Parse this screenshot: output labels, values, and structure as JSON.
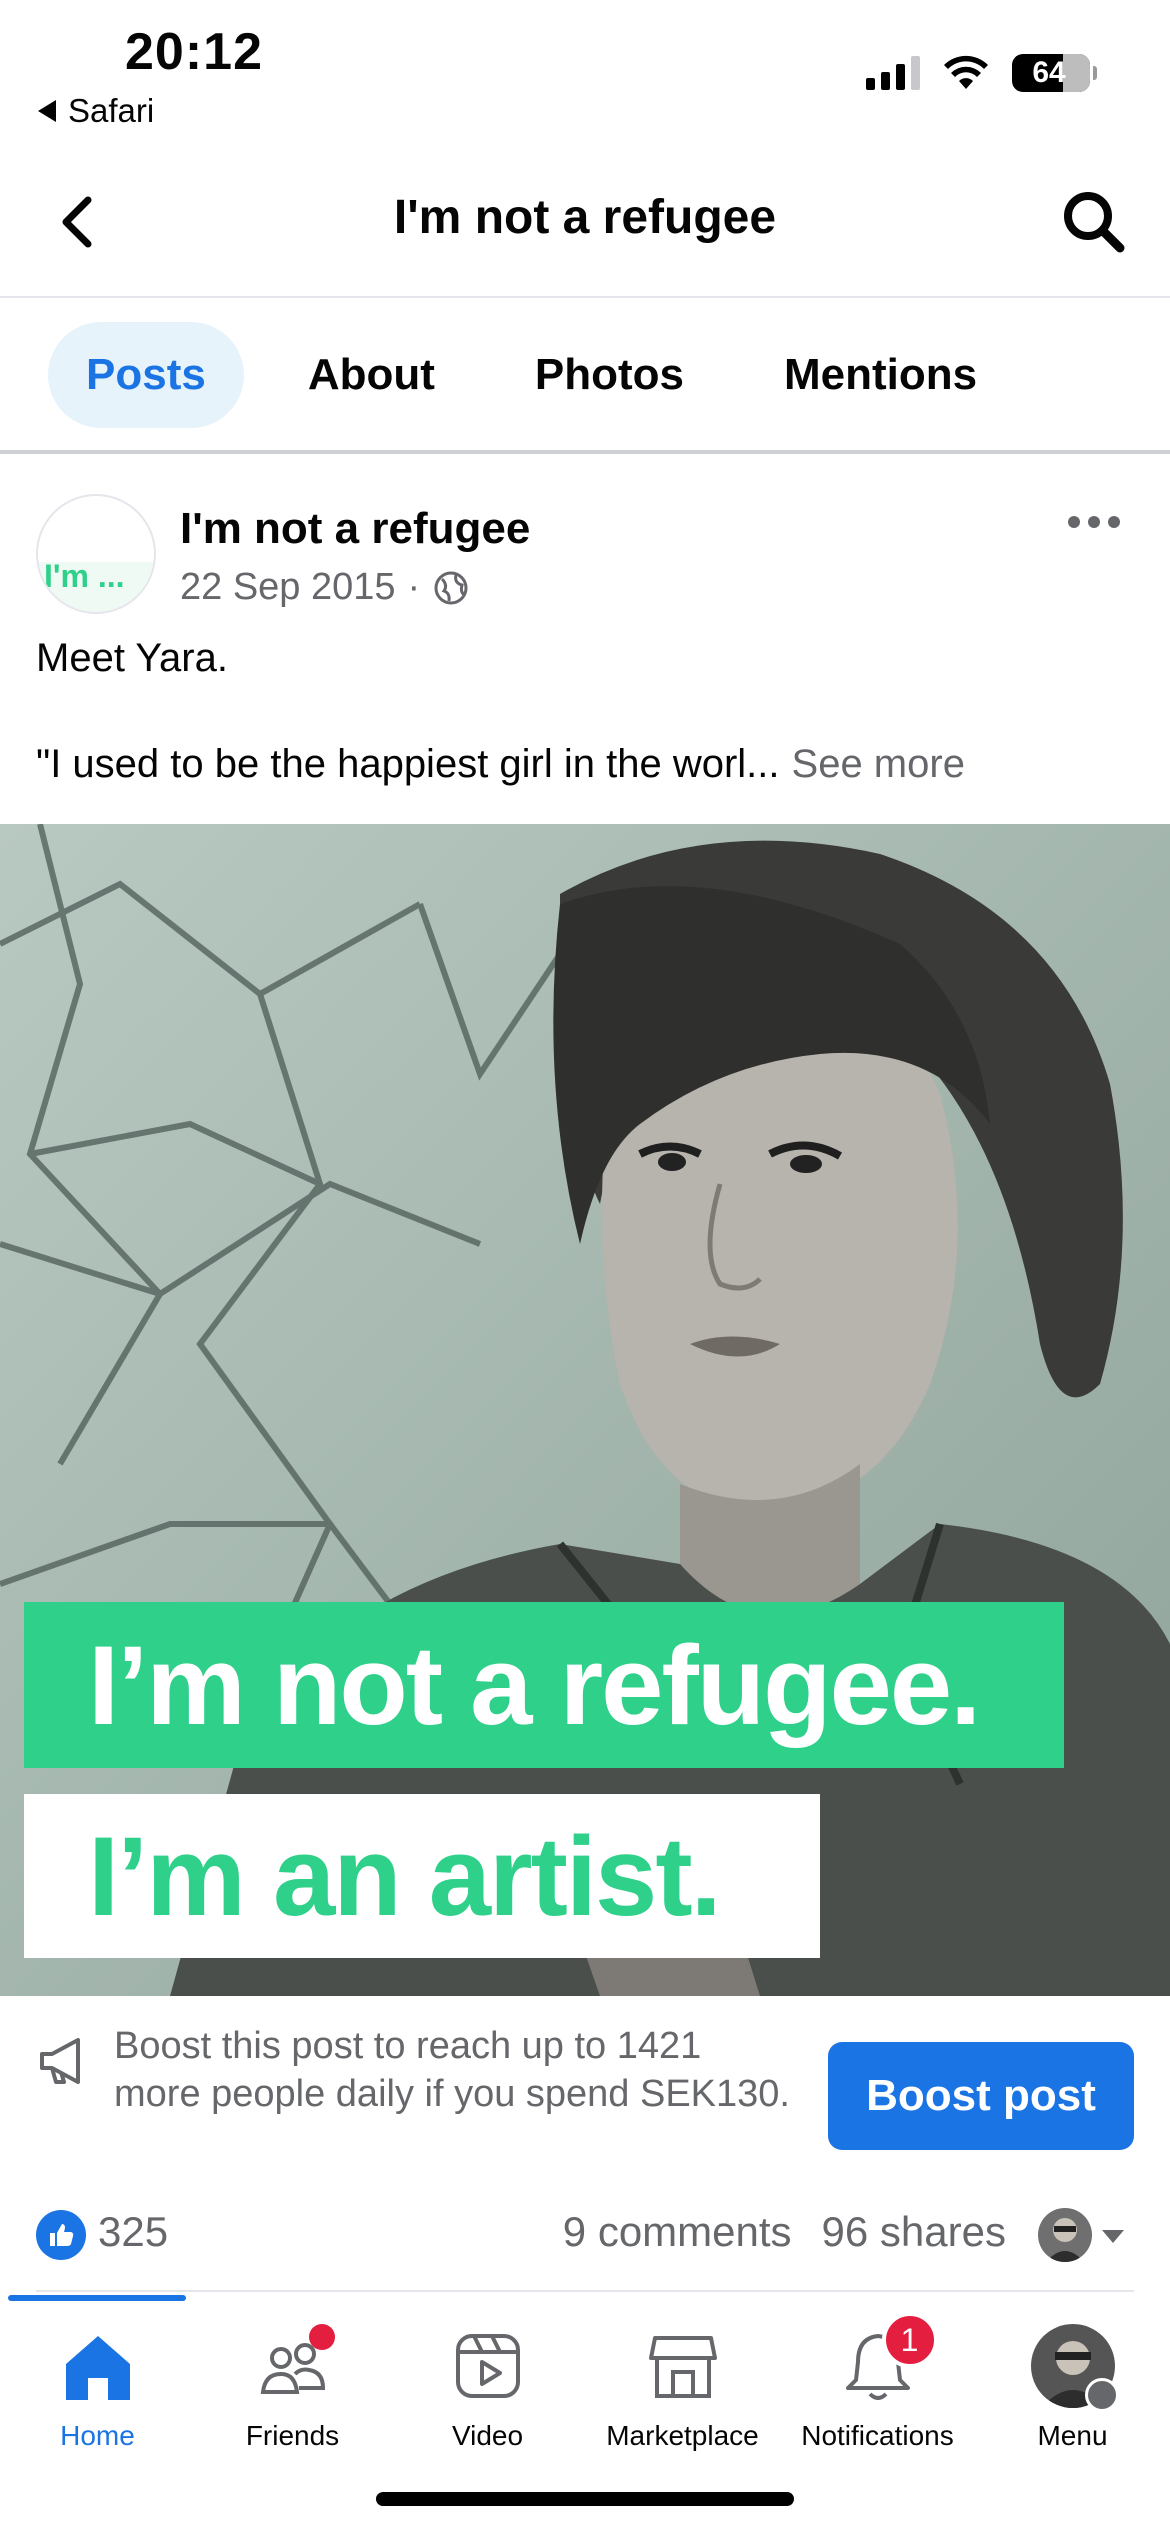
{
  "status_bar": {
    "time": "20:12",
    "back_app": "Safari",
    "battery": "64"
  },
  "header": {
    "title": "I'm not a refugee"
  },
  "tabs": [
    {
      "label": "Posts",
      "active": true
    },
    {
      "label": "About"
    },
    {
      "label": "Photos"
    },
    {
      "label": "Mentions"
    }
  ],
  "post": {
    "avatar_text": "I'm ...",
    "author": "I'm not a refugee",
    "date": "22 Sep 2015",
    "separator": "·",
    "text_line_1": "Meet Yara.",
    "text_line_2": "\"I used to be the happiest girl in the worl...",
    "see_more": "See more",
    "image": {
      "banner_1": "I’m not a refugee.",
      "banner_2": "I’m an artist."
    }
  },
  "boost": {
    "text": "Boost this post to reach up to 1421 more people daily if you spend SEK130.",
    "button": "Boost post"
  },
  "reactions": {
    "likes": "325",
    "comments": "9 comments",
    "shares": "96 shares"
  },
  "tabbar": [
    {
      "label": "Home",
      "icon": "home-icon",
      "active": true
    },
    {
      "label": "Friends",
      "icon": "friends-icon",
      "dot": true
    },
    {
      "label": "Video",
      "icon": "video-icon"
    },
    {
      "label": "Marketplace",
      "icon": "marketplace-icon"
    },
    {
      "label": "Notifications",
      "icon": "bell-icon",
      "badge": "1"
    },
    {
      "label": "Menu",
      "icon": "menu-avatar-icon"
    }
  ],
  "colors": {
    "accent": "#1b74e4",
    "brand_green": "#2fd08a",
    "badge_red": "#e41e3f",
    "muted": "#65676b"
  }
}
